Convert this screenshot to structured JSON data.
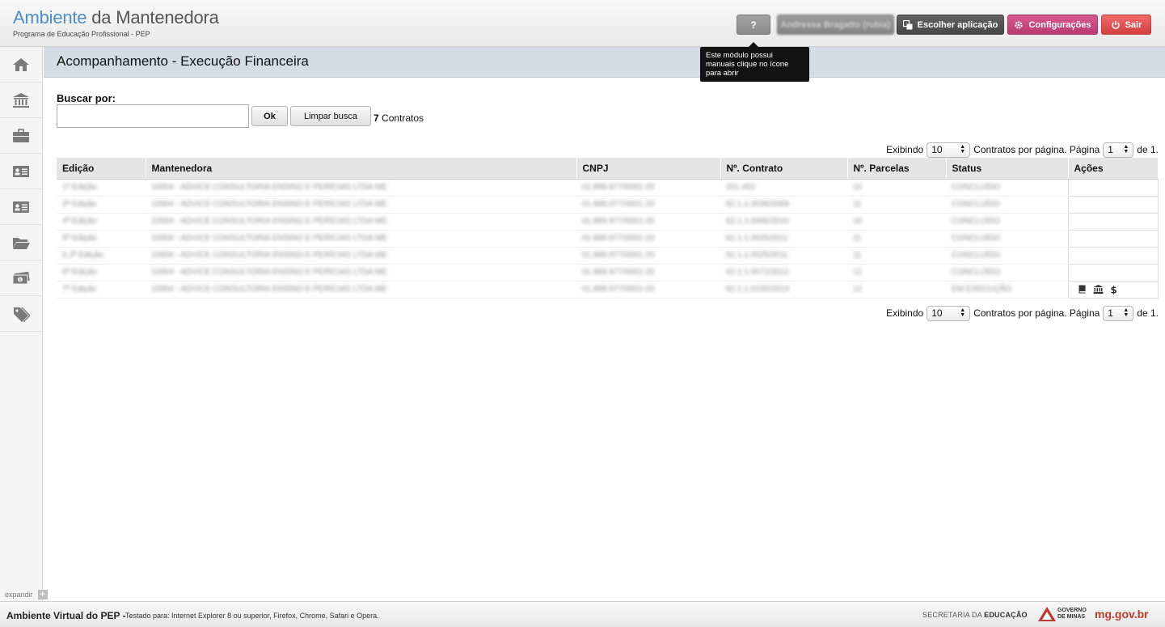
{
  "header": {
    "title_part1": "Ambiente",
    "title_part2": " da Mantenedora",
    "subtitle": "Programa de Educação Profissional - PEP",
    "help_label": "?",
    "user_label": "Andressa Bragatto (rubia)",
    "choose_app_label": "Escolher aplicação",
    "settings_label": "Configurações",
    "exit_label": "Sair",
    "tooltip": "Este módulo possui manuais clique no ícone para abrir"
  },
  "sidebar": {
    "items": [
      {
        "icon": "home-icon"
      },
      {
        "icon": "bank-icon"
      },
      {
        "icon": "briefcase-icon"
      },
      {
        "icon": "id-card-icon"
      },
      {
        "icon": "id-card-icon"
      },
      {
        "icon": "folder-icon"
      },
      {
        "icon": "money-icon"
      },
      {
        "icon": "tag-icon"
      }
    ],
    "expand_label": "expandir"
  },
  "page": {
    "title": "Acompanhamento - Execução Financeira"
  },
  "search": {
    "label": "Buscar por:",
    "value": "",
    "ok_label": "Ok",
    "clear_label": "Limpar busca",
    "count_number": "7",
    "count_label": " Contratos"
  },
  "pager": {
    "prefix": "Exibindo",
    "per_page": "10",
    "mid": "Contratos por página. Página",
    "page": "1",
    "suffix": "de 1."
  },
  "table": {
    "headers": [
      "Edição",
      "Mantenedora",
      "CNPJ",
      "Nº. Contrato",
      "Nº. Parcelas",
      "Status",
      "Ações"
    ],
    "rows": [
      [
        "1ª Edição",
        "10004 - ADVICE CONSULTORIA ENSINO E PERÍCIAS LTDA ME",
        "01.889.977/0001-20",
        "201.462",
        "10",
        "CONCLUÍDO"
      ],
      [
        "2ª Edição",
        "10004 - ADVICE CONSULTORIA ENSINO E PERÍCIAS LTDA ME",
        "01.889.977/0001-20",
        "62.1.1.0036/2009",
        "11",
        "CONCLUÍDO"
      ],
      [
        "4ª Edição",
        "10004 - ADVICE CONSULTORIA ENSINO E PERÍCIAS LTDA ME",
        "01.889.977/0001-20",
        "62.1.1.0066/2010",
        "10",
        "CONCLUÍDO"
      ],
      [
        "5ª Edição",
        "10004 - ADVICE CONSULTORIA ENSINO E PERÍCIAS LTDA ME",
        "01.889.977/0001-20",
        "62.1.1.0025/2011",
        "11",
        "CONCLUÍDO"
      ],
      [
        "5.2ª Edição",
        "10004 - ADVICE CONSULTORIA ENSINO E PERÍCIAS LTDA ME",
        "01.889.977/0001-20",
        "62.1.1.0025/2011",
        "11",
        "CONCLUÍDO"
      ],
      [
        "6ª Edição",
        "10004 - ADVICE CONSULTORIA ENSINO E PERÍCIAS LTDA ME",
        "01.889.977/0001-20",
        "62.1.1.0072/2012",
        "12",
        "CONCLUÍDO"
      ],
      [
        "7ª Edição",
        "10004 - ADVICE CONSULTORIA ENSINO E PERÍCIAS LTDA ME",
        "01.889.977/0001-20",
        "62.1.1.0150/2013",
        "12",
        "EM EXECUÇÃO"
      ]
    ]
  },
  "footer": {
    "app_name": "Ambiente Virtual do PEP -",
    "tested": "Testado para: Internet Explorer 8 ou superior, Firefox, Chrome, Safari e Opera.",
    "sec_prefix": "SECRETARIA DA ",
    "sec_bold": "EDUCAÇÃO",
    "gov_line1": "GOVERNO",
    "gov_line2": "DE MINAS",
    "site": "mg.gov.br"
  },
  "colors": {
    "accent_blue": "#4d8fc9",
    "config_pink": "#c8457c",
    "exit_red": "#e04d4d",
    "title_band": "#d4dde6"
  }
}
